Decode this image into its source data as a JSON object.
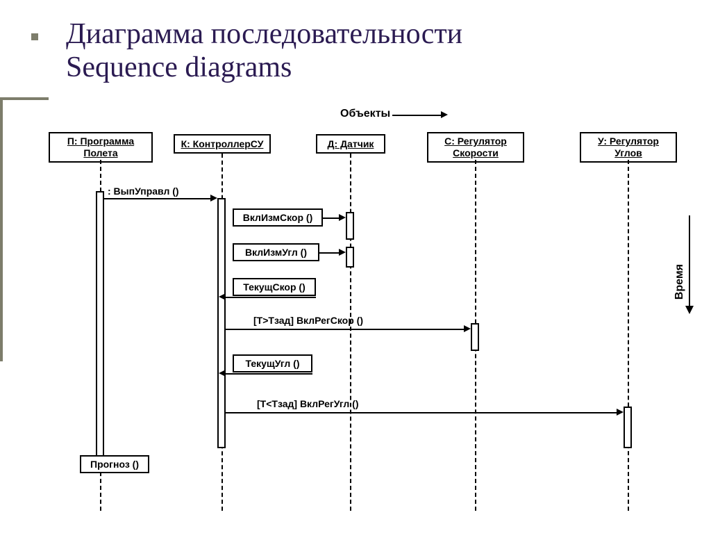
{
  "title_line1": "Диаграмма последовательности",
  "title_line2": "Sequence diagrams",
  "labels": {
    "objects": "Объекты",
    "time": "Время"
  },
  "participants": {
    "p": "П: Программа Полета",
    "k": "К: КонтроллерСУ",
    "d": "Д: Датчик",
    "s": "С: Регулятор Скорости",
    "u": "У: Регулятор Углов"
  },
  "messages": {
    "m1": ": ВыпУправл ()",
    "m2": "ВклИзмСкор ()",
    "m3": "ВклИзмУгл ()",
    "m4": "ТекущСкор ()",
    "m5": "[Т>Тзад] ВклРегСкор ()",
    "m6": "ТекущУгл ()",
    "m7": "[Т<Тзад] ВклРегУгл ()",
    "m8": "Прогноз ()"
  }
}
